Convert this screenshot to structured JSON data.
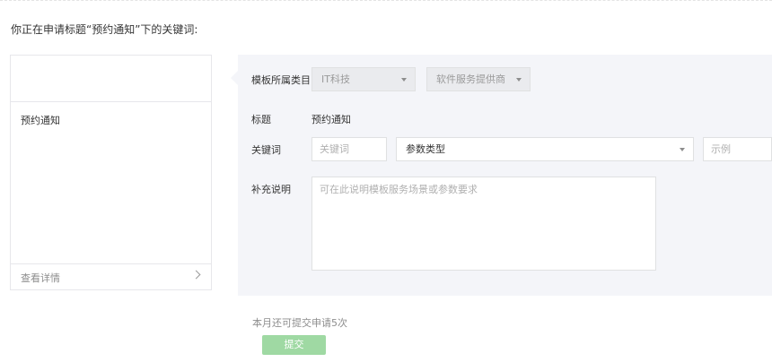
{
  "intro_text": "你正在申请标题“预约通知”下的关键词:",
  "preview": {
    "title": "预约通知",
    "footer_label": "查看详情"
  },
  "form": {
    "category_label": "模板所属类目",
    "category_primary": "IT科技",
    "category_secondary": "软件服务提供商",
    "title_label": "标题",
    "title_value": "预约通知",
    "keyword_label": "关键词",
    "keyword_placeholder": "关键词",
    "param_type_value": "参数类型",
    "example_placeholder": "示例",
    "note_label": "补充说明",
    "note_placeholder": "可在此说明模板服务场景或参数要求"
  },
  "quota_text": "本月还可提交申请5次",
  "submit_label": "提交",
  "colors": {
    "panel_bg": "#f4f5f9",
    "submit_bg": "#9fd9a3"
  }
}
